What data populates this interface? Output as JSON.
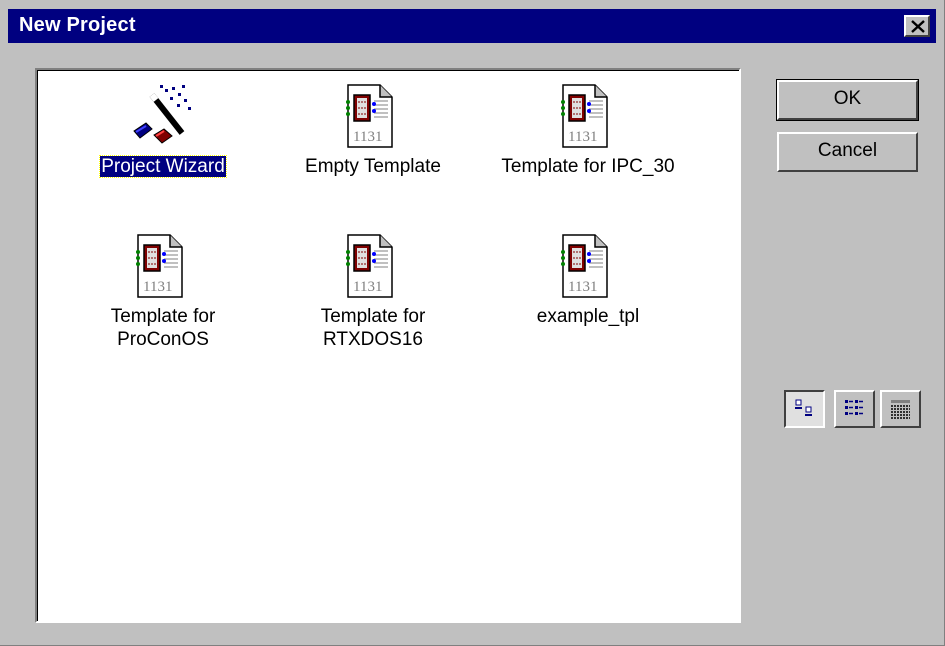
{
  "window": {
    "title": "New Project"
  },
  "templates": [
    {
      "label": "Project Wizard",
      "icon": "wizard-wand-icon",
      "selected": true
    },
    {
      "label": "Empty Template",
      "icon": "template-1131-icon",
      "selected": false
    },
    {
      "label": "Template for IPC_30",
      "icon": "template-1131-icon",
      "selected": false
    },
    {
      "label": "Template for\nProConOS",
      "icon": "template-1131-icon",
      "selected": false
    },
    {
      "label": "Template for\nRTXDOS16",
      "icon": "template-1131-icon",
      "selected": false
    },
    {
      "label": "example_tpl",
      "icon": "template-1131-icon",
      "selected": false
    }
  ],
  "buttons": {
    "ok": "OK",
    "cancel": "Cancel"
  },
  "template_icon_text": "1131",
  "view_modes": [
    {
      "name": "large-icons",
      "pressed": true
    },
    {
      "name": "list",
      "pressed": false
    },
    {
      "name": "details",
      "pressed": false
    }
  ],
  "colors": {
    "titlebar": "#000080",
    "selection": "#000080",
    "face": "#c0c0c0"
  }
}
